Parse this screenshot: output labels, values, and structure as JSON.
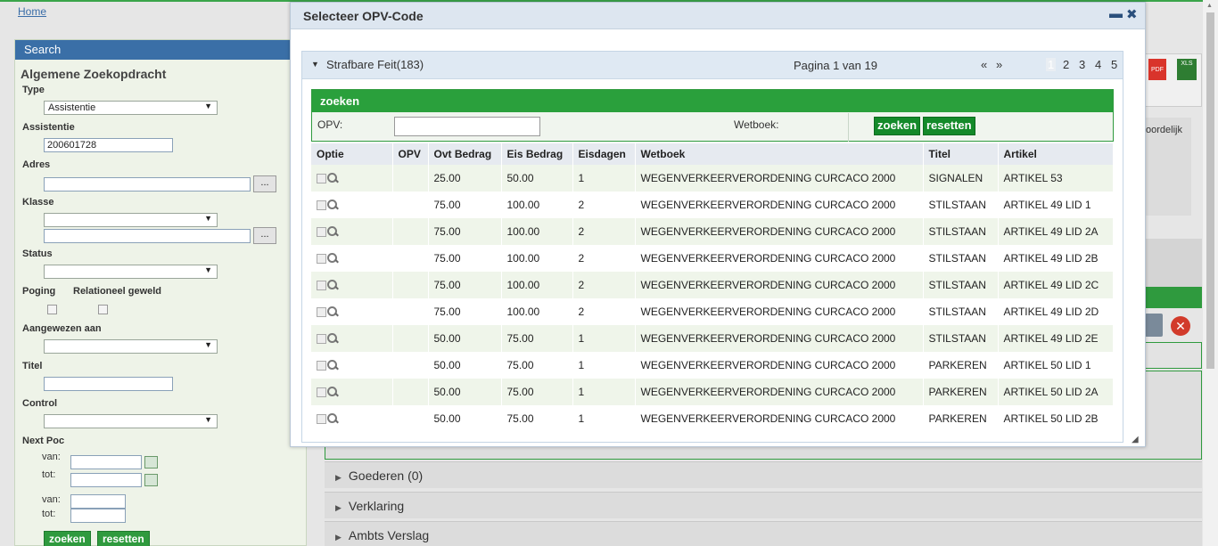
{
  "breadcrumb": {
    "home": "Home"
  },
  "search_panel": {
    "header": "Search",
    "title": "Algemene Zoekopdracht",
    "type_label": "Type",
    "type_value": "Assistentie",
    "assistentie_label": "Assistentie",
    "assistentie_value": "200601728",
    "adres_label": "Adres",
    "klasse_label": "Klasse",
    "status_label": "Status",
    "poging_label": "Poging",
    "relationeel_label": "Relationeel geweld",
    "aangewezen_label": "Aangewezen aan",
    "titel_label": "Titel",
    "control_label": "Control",
    "nextpoc_label": "Next Poc",
    "van_label": "van:",
    "tot_label": "tot:",
    "dots": "...",
    "search_button": "zoeken",
    "reset_button": "resetten"
  },
  "background": {
    "right_label": "oordelijk",
    "accordion": [
      {
        "label": "Goederen (0)"
      },
      {
        "label": "Verklaring"
      },
      {
        "label": "Ambts Verslag"
      }
    ],
    "pdf_label": "PDF",
    "xls_label": "XLS"
  },
  "modal": {
    "title": "Selecteer OPV-Code",
    "panel_title": "Strafbare Feit(183)",
    "pagination_text": "Pagina 1 van 19",
    "prev": "«",
    "next": "»",
    "pages": [
      "1",
      "2",
      "3",
      "4",
      "5"
    ],
    "search_header": "zoeken",
    "opv_label": "OPV:",
    "wetboek_label": "Wetboek:",
    "search_button": "zoeken",
    "reset_button": "resetten",
    "columns": [
      "Optie",
      "OPV",
      "Ovt Bedrag",
      "Eis Bedrag",
      "Eisdagen",
      "Wetboek",
      "Titel",
      "Artikel"
    ],
    "rows": [
      {
        "opv": "",
        "ovt": "25.00",
        "eis": "50.00",
        "dagen": "1",
        "wetboek": "WEGENVERKEERVERORDENING CURCACO 2000",
        "titel": "SIGNALEN",
        "artikel": "ARTIKEL 53"
      },
      {
        "opv": "",
        "ovt": "75.00",
        "eis": "100.00",
        "dagen": "2",
        "wetboek": "WEGENVERKEERVERORDENING CURCACO 2000",
        "titel": "STILSTAAN",
        "artikel": "ARTIKEL 49 LID 1"
      },
      {
        "opv": "",
        "ovt": "75.00",
        "eis": "100.00",
        "dagen": "2",
        "wetboek": "WEGENVERKEERVERORDENING CURCACO 2000",
        "titel": "STILSTAAN",
        "artikel": "ARTIKEL 49 LID 2A"
      },
      {
        "opv": "",
        "ovt": "75.00",
        "eis": "100.00",
        "dagen": "2",
        "wetboek": "WEGENVERKEERVERORDENING CURCACO 2000",
        "titel": "STILSTAAN",
        "artikel": "ARTIKEL 49 LID 2B"
      },
      {
        "opv": "",
        "ovt": "75.00",
        "eis": "100.00",
        "dagen": "2",
        "wetboek": "WEGENVERKEERVERORDENING CURCACO 2000",
        "titel": "STILSTAAN",
        "artikel": "ARTIKEL 49 LID 2C"
      },
      {
        "opv": "",
        "ovt": "75.00",
        "eis": "100.00",
        "dagen": "2",
        "wetboek": "WEGENVERKEERVERORDENING CURCACO 2000",
        "titel": "STILSTAAN",
        "artikel": "ARTIKEL 49 LID 2D"
      },
      {
        "opv": "",
        "ovt": "50.00",
        "eis": "75.00",
        "dagen": "1",
        "wetboek": "WEGENVERKEERVERORDENING CURCACO 2000",
        "titel": "STILSTAAN",
        "artikel": "ARTIKEL 49 LID 2E"
      },
      {
        "opv": "",
        "ovt": "50.00",
        "eis": "75.00",
        "dagen": "1",
        "wetboek": "WEGENVERKEERVERORDENING CURCACO 2000",
        "titel": "PARKEREN",
        "artikel": "ARTIKEL 50 LID 1"
      },
      {
        "opv": "",
        "ovt": "50.00",
        "eis": "75.00",
        "dagen": "1",
        "wetboek": "WEGENVERKEERVERORDENING CURCACO 2000",
        "titel": "PARKEREN",
        "artikel": "ARTIKEL 50 LID 2A"
      },
      {
        "opv": "",
        "ovt": "50.00",
        "eis": "75.00",
        "dagen": "1",
        "wetboek": "WEGENVERKEERVERORDENING CURCACO 2000",
        "titel": "PARKEREN",
        "artikel": "ARTIKEL 50 LID 2B"
      }
    ]
  }
}
